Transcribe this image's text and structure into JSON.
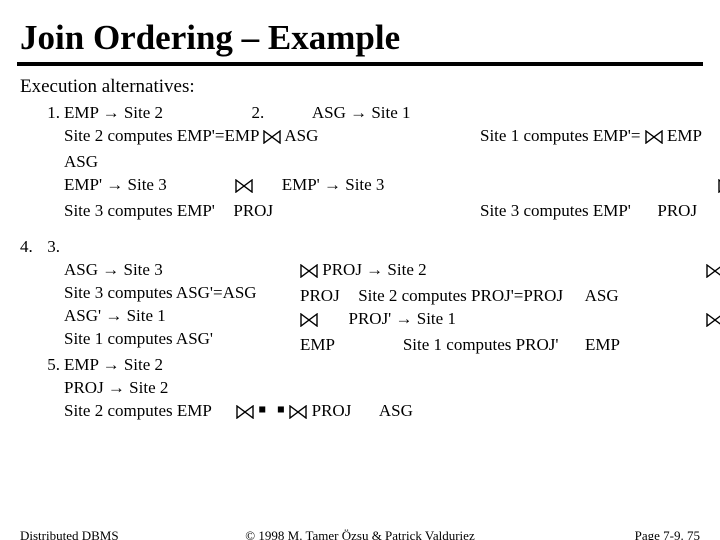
{
  "title": "Join Ordering – Example",
  "subhead": "Execution alternatives:",
  "arrow": "→",
  "block1": {
    "num": "1.",
    "l1": "EMP → Site 2",
    "l2a": "Site 2 computes EMP'=EMP",
    "l2b": "ASG",
    "l3": "ASG",
    "l4": "EMP' → Site 3",
    "l5a": "Site 3 computes EMP'",
    "l5b": "PROJ"
  },
  "block2": {
    "num": "2.",
    "l1": "ASG → Site 1",
    "l2a": "Site 1 computes EMP'=",
    "l2b": "EMP",
    "l4": "EMP' → Site 3",
    "l5a": "Site 3 computes EMP'",
    "l5b": "PROJ"
  },
  "block3": {
    "num": "3.",
    "l1": "ASG → Site 3",
    "l2a": "Site 3 computes ASG'=ASG",
    "l2b": "PROJ",
    "l3": "ASG' → Site 1",
    "l4a": "Site 1 computes ASG'",
    "l4b": "EMP"
  },
  "block4": {
    "num": "4.",
    "l1": "PROJ → Site 2",
    "l2a": "Site 2 computes PROJ'=PROJ",
    "l2b": "ASG",
    "l3": "PROJ' → Site 1",
    "l4a": "Site 1 computes PROJ'",
    "l4b": "EMP"
  },
  "block5": {
    "num": "5.",
    "l1": "EMP → Site 2",
    "l2": "PROJ → Site 2",
    "l3a": "Site 2 computes EMP",
    "l3b": "PROJ",
    "l3c": "ASG",
    "boxes": "￭ ￭"
  },
  "footer": {
    "left": "Distributed DBMS",
    "mid": "© 1998 M. Tamer Özsu & Patrick Valduriez",
    "right": "Page 7-9. 75"
  }
}
